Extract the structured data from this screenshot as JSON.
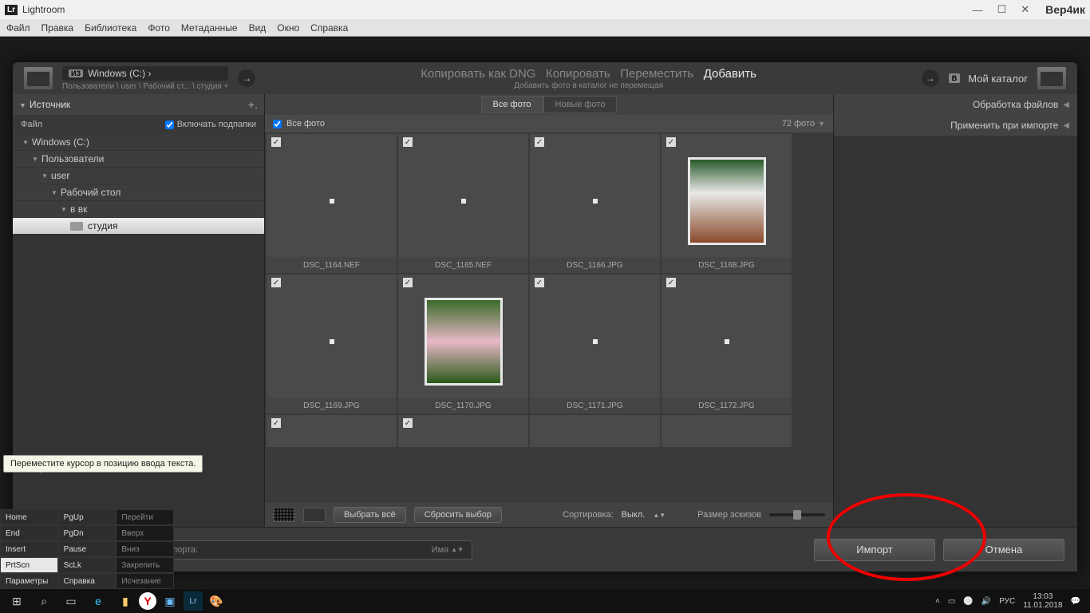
{
  "title": "Lightroom",
  "user": "Вер4ик",
  "menu": [
    "Файл",
    "Правка",
    "Библиотека",
    "Фото",
    "Метаданные",
    "Вид",
    "Окно",
    "Справка"
  ],
  "header": {
    "drive_badge": "ИЗ",
    "drive": "Windows (C:) ›",
    "path": "Пользователи \\ user \\ Рабочий ст... \\ студия +",
    "actions": {
      "dng": "Копировать как DNG",
      "copy": "Копировать",
      "move": "Переместить",
      "add": "Добавить"
    },
    "sub": "Добавить фото в каталог не перемещая",
    "dest_badge": "В",
    "dest": "Мой каталог"
  },
  "source": {
    "title": "Источник",
    "file": "Файл",
    "include": "Включать подпапки",
    "tree": [
      "Windows (C:)",
      "Пользователи",
      "user",
      "Рабочий стол",
      "в вк",
      "студия"
    ]
  },
  "tabs": {
    "all": "Все фото",
    "new": "Новые фото"
  },
  "bar": {
    "label": "Все фото",
    "count": "72 фото"
  },
  "thumbs": [
    "DSC_1164.NEF",
    "DSC_1165.NEF",
    "DSC_1166.JPG",
    "DSC_1168.JPG",
    "DSC_1169.JPG",
    "DSC_1170.JPG",
    "DSC_1171.JPG",
    "DSC_1172.JPG"
  ],
  "ctlbar": {
    "selall": "Выбрать всё",
    "reset": "Сбросить выбор",
    "sort": "Сортировка:",
    "sortval": "Выкл.",
    "thumbsize": "Размер эскизов"
  },
  "right": {
    "p1": "Обработка файлов",
    "p2": "Применить при импорте"
  },
  "preset": {
    "label": "Пресет импорта:",
    "val": "Имя"
  },
  "buttons": {
    "import": "Импорт",
    "cancel": "Отмена"
  },
  "tooltip": "Переместите курсор в позицию ввода текста.",
  "osk": [
    [
      "Home",
      "PgUp",
      "Перейти"
    ],
    [
      "End",
      "PgDn",
      "Вверх"
    ],
    [
      "Insert",
      "Pause",
      "Вниз"
    ],
    [
      "PrtScn",
      "ScLk",
      "Закрепить"
    ],
    [
      "Параметры",
      "Справка",
      "Исчезание"
    ]
  ],
  "clock": {
    "time": "13:03",
    "date": "11.01.2018"
  },
  "lang": "РУС"
}
